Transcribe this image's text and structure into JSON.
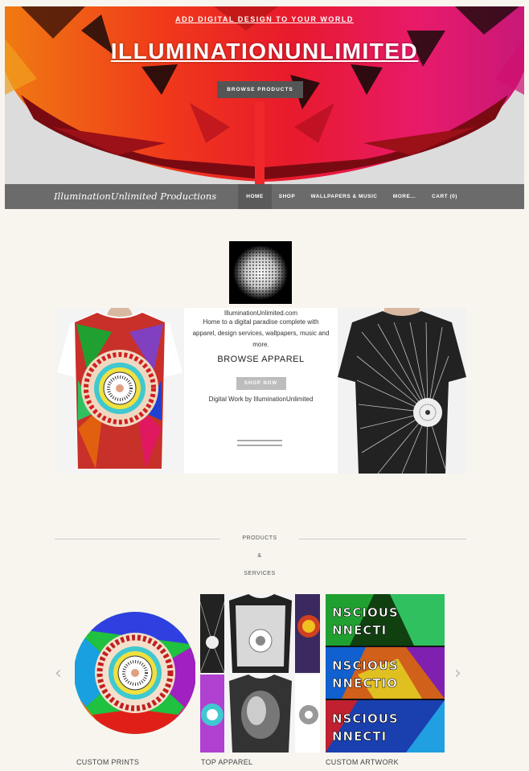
{
  "hero": {
    "tagline": "ADD DIGITAL DESIGN TO YOUR WORLD",
    "title": "ILLUMINATIONUNLIMITED",
    "button": "BROWSE PRODUCTS"
  },
  "nav": {
    "brand": "IlluminationUnlimited Productions",
    "items": [
      "HOME",
      "SHOP",
      "WALLPAPERS & MUSIC",
      "MORE...",
      "CART (0)"
    ]
  },
  "intro": {
    "site": "IlluminationUnlimited.com",
    "description": "Home to a digital paradise complete with apparel, design services, wallpapers, music and more.",
    "heading": "BROWSE APPAREL",
    "button": "SHOP NOW",
    "credit": "Digital Work by IlluminationUnlimited"
  },
  "products": {
    "heading": [
      "PRODUCTS",
      "&",
      "SERVICES"
    ],
    "items": [
      {
        "label": "CUSTOM PRINTS"
      },
      {
        "label": "TOP APPAREL"
      },
      {
        "label": "CUSTOM ARTWORK"
      }
    ]
  },
  "colors": {
    "nav_bg": "#6b6b6b",
    "page_bg": "#f8f5ef",
    "hero_red": "#e8202e",
    "hero_orange": "#f06a10"
  }
}
